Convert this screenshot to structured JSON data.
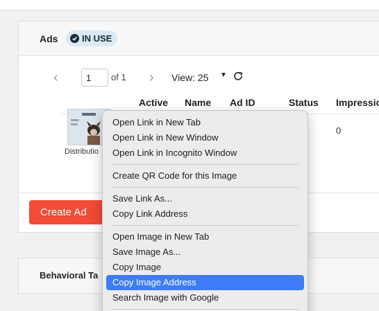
{
  "ads_section": {
    "title": "Ads",
    "status_badge": "IN USE"
  },
  "pagination": {
    "prev_icon": "chevron-left-icon",
    "page_value": "1",
    "of_text": "of 1",
    "next_icon": "chevron-right-icon",
    "view_label": "View: 25"
  },
  "table": {
    "columns": [
      "Active",
      "Name",
      "Ad ID",
      "Status",
      "Impressio"
    ],
    "rows": [
      {
        "thumbnail_label": "Distributio",
        "impressions": "0"
      }
    ]
  },
  "create_button": "Create Ad",
  "behavioral_section": {
    "title": "Behavioral Ta"
  },
  "context_menu": {
    "groups": [
      [
        "Open Link in New Tab",
        "Open Link in New Window",
        "Open Link in Incognito Window"
      ],
      [
        "Create QR Code for this Image"
      ],
      [
        "Save Link As...",
        "Copy Link Address"
      ],
      [
        "Open Image in New Tab",
        "Save Image As...",
        "Copy Image",
        "Copy Image Address",
        "Search Image with Google"
      ]
    ],
    "selected": "Copy Image Address"
  },
  "colors": {
    "accent_red": "#f24b36",
    "badge_bg": "#dbe9f7",
    "menu_highlight": "#3d7cf5"
  }
}
